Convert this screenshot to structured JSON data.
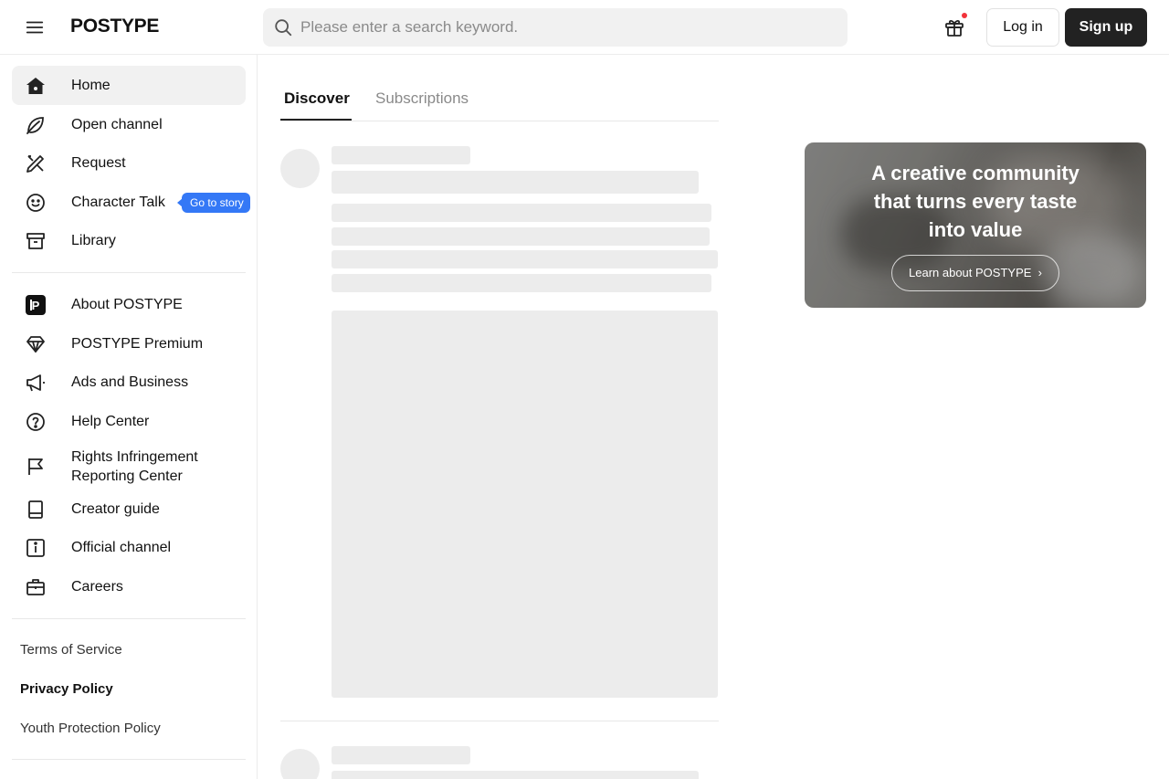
{
  "header": {
    "logo": "POSTYPE",
    "search_placeholder": "Please enter a search keyword.",
    "login_label": "Log in",
    "signup_label": "Sign up",
    "icons": {
      "menu": "hamburger-menu-icon",
      "search": "search-icon",
      "gift": "gift-icon"
    },
    "notification_dot_color": "#f2323a"
  },
  "sidebar": {
    "primary": [
      {
        "label": "Home",
        "icon": "home-icon",
        "active": true
      },
      {
        "label": "Open channel",
        "icon": "leaf-icon"
      },
      {
        "label": "Request",
        "icon": "pencil-ruler-icon"
      },
      {
        "label": "Character Talk",
        "icon": "smiley-chat-icon",
        "badge": "Go to story"
      },
      {
        "label": "Library",
        "icon": "archive-box-icon"
      }
    ],
    "secondary": [
      {
        "label": "About POSTYPE",
        "icon": "postype-logo-icon"
      },
      {
        "label": "POSTYPE Premium",
        "icon": "diamond-icon"
      },
      {
        "label": "Ads and Business",
        "icon": "megaphone-icon"
      },
      {
        "label": "Help Center",
        "icon": "question-circle-icon"
      },
      {
        "label": "Rights Infringement Reporting Center",
        "icon": "flag-icon"
      },
      {
        "label": "Creator guide",
        "icon": "book-icon"
      },
      {
        "label": "Official channel",
        "icon": "info-square-icon"
      },
      {
        "label": "Careers",
        "icon": "briefcase-icon"
      }
    ],
    "footer_links": [
      {
        "label": "Terms of Service",
        "bold": false
      },
      {
        "label": "Privacy Policy",
        "bold": true
      },
      {
        "label": "Youth Protection Policy",
        "bold": false
      }
    ]
  },
  "tabs": [
    {
      "label": "Discover",
      "active": true
    },
    {
      "label": "Subscriptions",
      "active": false
    }
  ],
  "banner": {
    "title_lines": [
      "A creative community",
      "that turns every taste",
      "into value"
    ],
    "button_label": "Learn about POSTYPE"
  },
  "colors": {
    "accent_badge": "#3478f6",
    "signup_button": "#222222",
    "skeleton": "#ececec"
  }
}
